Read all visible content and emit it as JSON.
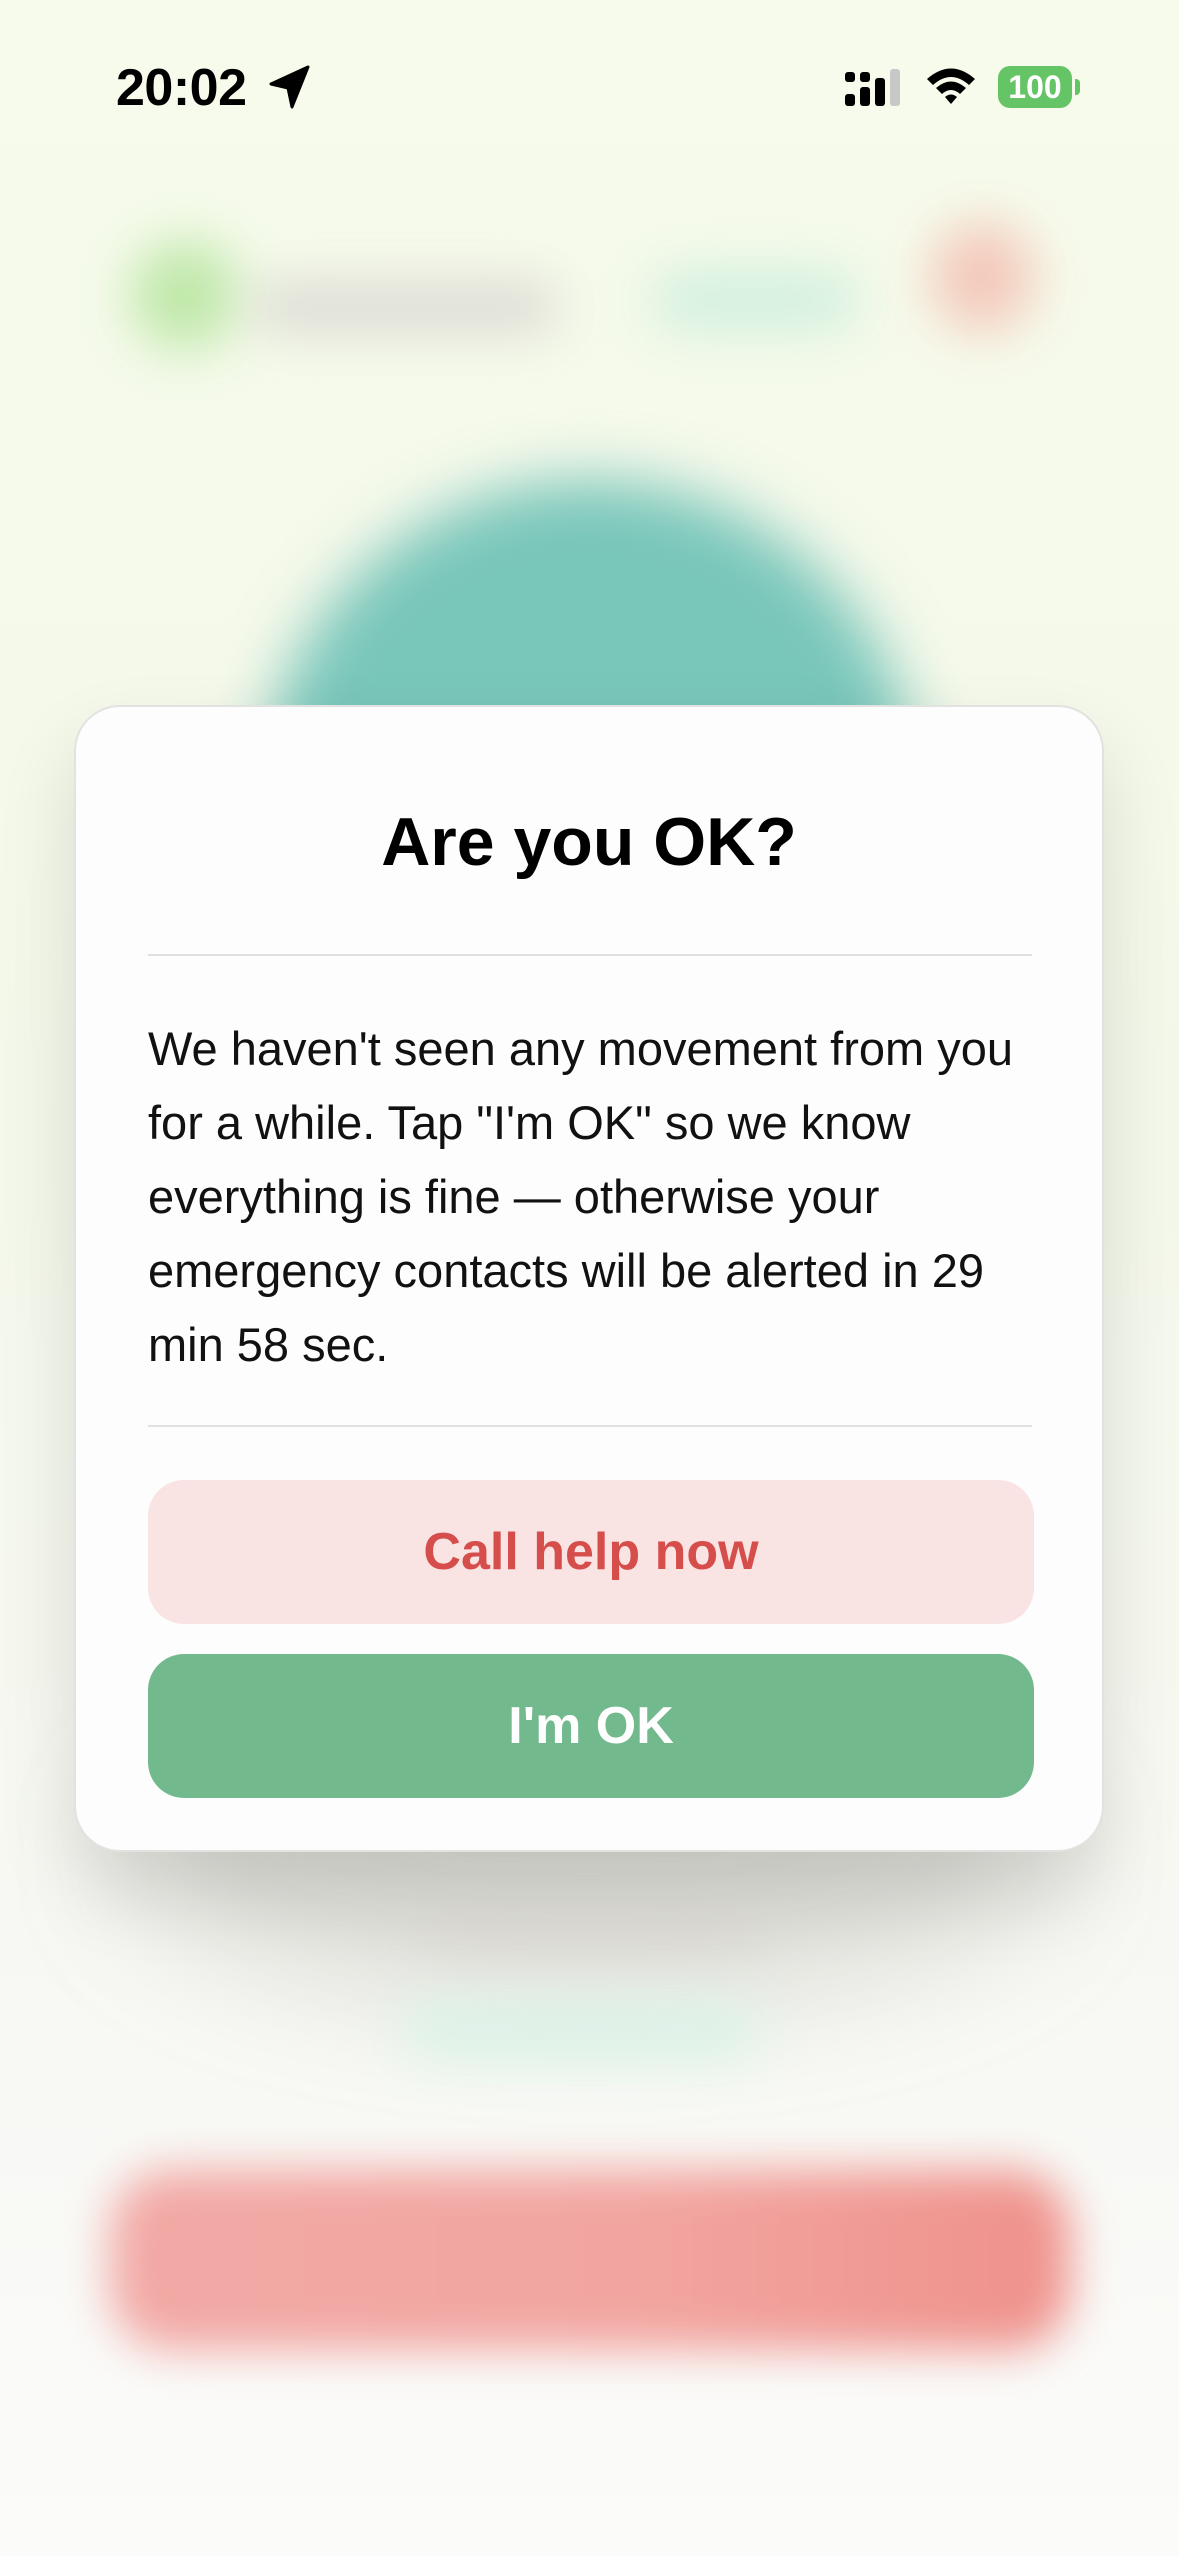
{
  "status_bar": {
    "time": "20:02",
    "battery": "100",
    "location_icon": "location-arrow-icon",
    "signal_icon": "cellular-signal-icon",
    "wifi_icon": "wifi-icon",
    "battery_icon": "battery-icon",
    "battery_color": "#65c466"
  },
  "dialog": {
    "title": "Are you OK?",
    "message": "We haven't seen any movement from you for a while. Tap \"I'm OK\" so we know everything is fine — otherwise your emergency contacts will be alerted in 29 min 58 sec.",
    "call_button": "Call help now",
    "ok_button": "I'm OK"
  },
  "colors": {
    "call_button_bg": "#f9e3e3",
    "call_button_text": "#d64e4b",
    "ok_button_bg": "#73b98e",
    "ok_button_text": "#ffffff"
  }
}
